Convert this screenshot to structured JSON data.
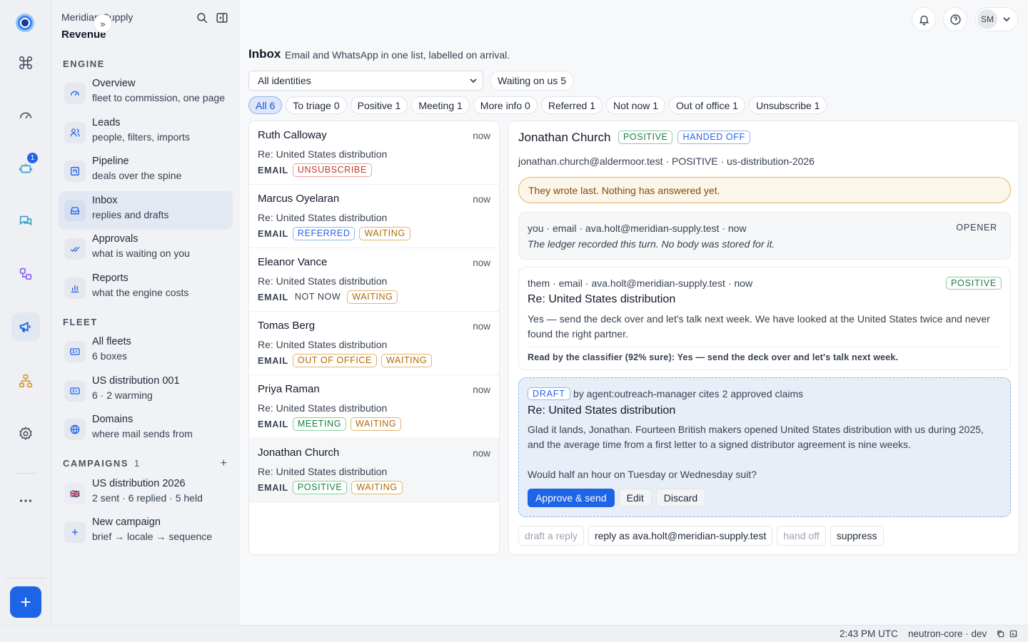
{
  "app": {
    "org_name": "Meridian Supply",
    "workspace": "Revenue",
    "collapse_glyph": "»"
  },
  "rail": {
    "badge_count": "1",
    "add_glyph": "+",
    "icons": [
      "command-icon",
      "gauge-icon",
      "robot-icon",
      "chat-icon",
      "workflow-icon",
      "megaphone-icon",
      "org-chart-icon",
      "settings-icon",
      "more-icon"
    ]
  },
  "sidebar": {
    "engine_label": "ENGINE",
    "engine_items": [
      {
        "title": "Overview",
        "sub": "fleet to commission, one page"
      },
      {
        "title": "Leads",
        "sub": "people, filters, imports"
      },
      {
        "title": "Pipeline",
        "sub": "deals over the spine"
      },
      {
        "title": "Inbox",
        "sub": "replies and drafts"
      },
      {
        "title": "Approvals",
        "sub": "what is waiting on you"
      },
      {
        "title": "Reports",
        "sub": "what the engine costs"
      }
    ],
    "fleet_label": "FLEET",
    "fleet_items": [
      {
        "title": "All fleets",
        "sub": "6 boxes"
      },
      {
        "title": "US distribution 001",
        "sub": "6 · 2 warming"
      },
      {
        "title": "Domains",
        "sub": "where mail sends from"
      }
    ],
    "campaigns_label": "CAMPAIGNS",
    "campaigns_count": "1",
    "campaigns_add": "+",
    "campaign_items": [
      {
        "title": "US distribution 2026",
        "sub": "2 sent · 6 replied · 5 held",
        "flag": "🇬🇧"
      },
      {
        "title": "New campaign",
        "sub": "brief → locale → sequence"
      }
    ]
  },
  "topbar": {
    "avatar_initials": "SM"
  },
  "inbox": {
    "title": "Inbox",
    "subtitle": "Email and WhatsApp in one list, labelled on arrival.",
    "identity_select": "All identities",
    "waiting_pill": "Waiting on us 5",
    "filters": [
      "All 6",
      "To triage 0",
      "Positive 1",
      "Meeting 1",
      "More info 0",
      "Referred 1",
      "Not now 1",
      "Out of office 1",
      "Unsubscribe 1"
    ]
  },
  "threads": [
    {
      "name": "Ruth Calloway",
      "time": "now",
      "subject": "Re: United States distribution",
      "channel": "EMAIL",
      "tags": [
        "UNSUBSCRIBE"
      ]
    },
    {
      "name": "Marcus Oyelaran",
      "time": "now",
      "subject": "Re: United States distribution",
      "channel": "EMAIL",
      "tags": [
        "REFERRED",
        "WAITING"
      ]
    },
    {
      "name": "Eleanor Vance",
      "time": "now",
      "subject": "Re: United States distribution",
      "channel": "EMAIL",
      "tags": [
        "NOT NOW",
        "WAITING"
      ]
    },
    {
      "name": "Tomas Berg",
      "time": "now",
      "subject": "Re: United States distribution",
      "channel": "EMAIL",
      "tags": [
        "OUT OF OFFICE",
        "WAITING"
      ]
    },
    {
      "name": "Priya Raman",
      "time": "now",
      "subject": "Re: United States distribution",
      "channel": "EMAIL",
      "tags": [
        "MEETING",
        "WAITING"
      ]
    },
    {
      "name": "Jonathan Church",
      "time": "now",
      "subject": "Re: United States distribution",
      "channel": "EMAIL",
      "tags": [
        "POSITIVE",
        "WAITING"
      ]
    }
  ],
  "detail": {
    "name": "Jonathan Church",
    "badge_positive": "POSITIVE",
    "badge_handed": "HANDED OFF",
    "meta": "jonathan.church@aldermoor.test · POSITIVE · us-distribution-2026",
    "warning": "They wrote last. Nothing has answered yet.",
    "opener": {
      "head": "you · email · ava.holt@meridian-supply.test · now",
      "label": "OPENER",
      "note": "The ledger recorded this turn. No body was stored for it."
    },
    "reply": {
      "head": "them · email · ava.holt@meridian-supply.test · now",
      "label": "POSITIVE",
      "subject": "Re: United States distribution",
      "body": "Yes — send the deck over and let's talk next week. We have looked at the United States twice and never found the right partner.",
      "classifier": "Read by the classifier (92% sure): Yes — send the deck over and let's talk next week."
    },
    "draft": {
      "tag": "DRAFT",
      "by": "by agent:outreach-manager   cites 2 approved claims",
      "subject": "Re: United States distribution",
      "para1": "Glad it lands, Jonathan. Fourteen British makers opened United States distribution with us during 2025, and the average time from a first letter to a signed distributor agreement is nine weeks.",
      "para2": "Would half an hour on Tuesday or Wednesday suit?",
      "approve": "Approve & send",
      "edit": "Edit",
      "discard": "Discard"
    },
    "actions": {
      "draft_reply": "draft a reply",
      "reply_as": "reply as ava.holt@meridian-supply.test",
      "hand_off": "hand off",
      "suppress": "suppress"
    }
  },
  "status": {
    "time": "2:43 PM UTC",
    "env": "neutron-core · dev"
  },
  "colors": {
    "accent": "#1d64e6",
    "positive": "#15803d",
    "warning": "#b26a00",
    "danger": "#c0392b"
  }
}
